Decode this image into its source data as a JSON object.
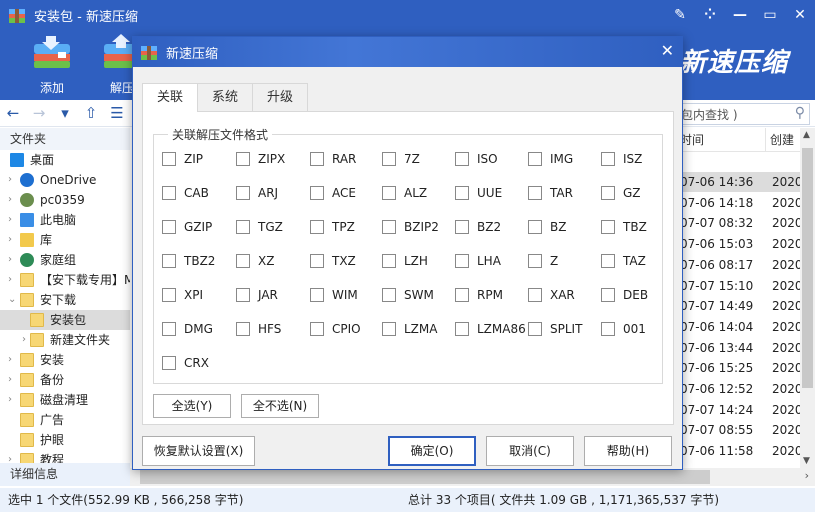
{
  "window": {
    "title": "安装包 - 新速压缩",
    "controls": [
      "edit-icon",
      "grid-icon",
      "minimize-icon",
      "maximize-icon",
      "close-icon"
    ]
  },
  "ribbon": {
    "buttons": [
      {
        "label": "添加",
        "icon": "add-archive-icon"
      },
      {
        "label": "解压",
        "icon": "extract-archive-icon"
      }
    ],
    "brand": "新速压缩"
  },
  "navbar": {
    "back": "←",
    "forward": "→",
    "dropdown": "▾",
    "up": "⇧",
    "view": "☰"
  },
  "search": {
    "placeholder": "包内查找 )",
    "icon": "search-icon"
  },
  "sidebar": {
    "header": "文件夹",
    "items": [
      {
        "label": "桌面",
        "icon": "desktop-icon",
        "expander": ""
      },
      {
        "label": "OneDrive",
        "icon": "cloud-icon",
        "expander": ">"
      },
      {
        "label": "pc0359",
        "icon": "user-icon",
        "expander": ">"
      },
      {
        "label": "此电脑",
        "icon": "computer-icon",
        "expander": ">"
      },
      {
        "label": "库",
        "icon": "library-icon",
        "expander": ">"
      },
      {
        "label": "家庭组",
        "icon": "homegroup-icon",
        "expander": ">"
      },
      {
        "label": "【安下载专用】M",
        "icon": "folder-icon",
        "expander": ">"
      },
      {
        "label": "安下载",
        "icon": "folder-icon",
        "expander": "v"
      },
      {
        "label": "安装包",
        "icon": "folder-icon",
        "expander": "",
        "selected": true
      },
      {
        "label": "新建文件夹",
        "icon": "folder-icon",
        "expander": ">"
      },
      {
        "label": "安装",
        "icon": "folder-icon",
        "expander": ">"
      },
      {
        "label": "备份",
        "icon": "folder-icon",
        "expander": ">"
      },
      {
        "label": "磁盘清理",
        "icon": "folder-icon",
        "expander": ">"
      },
      {
        "label": "广告",
        "icon": "folder-icon",
        "expander": ""
      },
      {
        "label": "护眼",
        "icon": "folder-icon",
        "expander": ""
      },
      {
        "label": "教程",
        "icon": "folder-icon",
        "expander": ">"
      }
    ],
    "details": "详细信息"
  },
  "filelist": {
    "columns": [
      "时间",
      "创建"
    ],
    "rows": [
      {
        "modified": "07-06 14:36",
        "created": "2020",
        "selected": true
      },
      {
        "modified": "07-06 14:18",
        "created": "2020"
      },
      {
        "modified": "07-07 08:32",
        "created": "2020"
      },
      {
        "modified": "07-06 15:03",
        "created": "2020"
      },
      {
        "modified": "07-06 08:17",
        "created": "2020"
      },
      {
        "modified": "07-07 15:10",
        "created": "2020"
      },
      {
        "modified": "07-07 14:49",
        "created": "2020"
      },
      {
        "modified": "07-06 14:04",
        "created": "2020"
      },
      {
        "modified": "07-06 13:44",
        "created": "2020"
      },
      {
        "modified": "07-06 15:25",
        "created": "2020"
      },
      {
        "modified": "07-06 12:52",
        "created": "2020"
      },
      {
        "modified": "07-07 14:24",
        "created": "2020"
      },
      {
        "modified": "07-07 08:55",
        "created": "2020"
      },
      {
        "modified": "07-06 11:58",
        "created": "2020"
      }
    ]
  },
  "statusbar": {
    "selection": "选中 1 个文件(552.99 KB , 566,258 字节)",
    "total": "总计 33 个项目( 文件共 1.09 GB , 1,171,365,537 字节)"
  },
  "dialog": {
    "title": "新速压缩",
    "tabs": [
      "关联",
      "系统",
      "升级"
    ],
    "active_tab": "关联",
    "group_label": "关联解压文件格式",
    "formats": [
      [
        "ZIP",
        "ZIPX",
        "RAR",
        "7Z",
        "ISO",
        "IMG",
        "ISZ"
      ],
      [
        "CAB",
        "ARJ",
        "ACE",
        "ALZ",
        "UUE",
        "TAR",
        "GZ"
      ],
      [
        "GZIP",
        "TGZ",
        "TPZ",
        "BZIP2",
        "BZ2",
        "BZ",
        "TBZ"
      ],
      [
        "TBZ2",
        "XZ",
        "TXZ",
        "LZH",
        "LHA",
        "Z",
        "TAZ"
      ],
      [
        "XPI",
        "JAR",
        "WIM",
        "SWM",
        "RPM",
        "XAR",
        "DEB"
      ],
      [
        "DMG",
        "HFS",
        "CPIO",
        "LZMA",
        "LZMA86",
        "SPLIT",
        "001"
      ],
      [
        "CRX"
      ]
    ],
    "select_all": "全选(Y)",
    "select_none": "全不选(N)",
    "restore_defaults": "恢复默认设置(X)",
    "ok": "确定(O)",
    "cancel": "取消(C)",
    "help": "帮助(H)"
  },
  "colors": {
    "accent": "#2f5fc0",
    "selection": "#dcdcdc",
    "status_bg": "#eaf1fb"
  }
}
